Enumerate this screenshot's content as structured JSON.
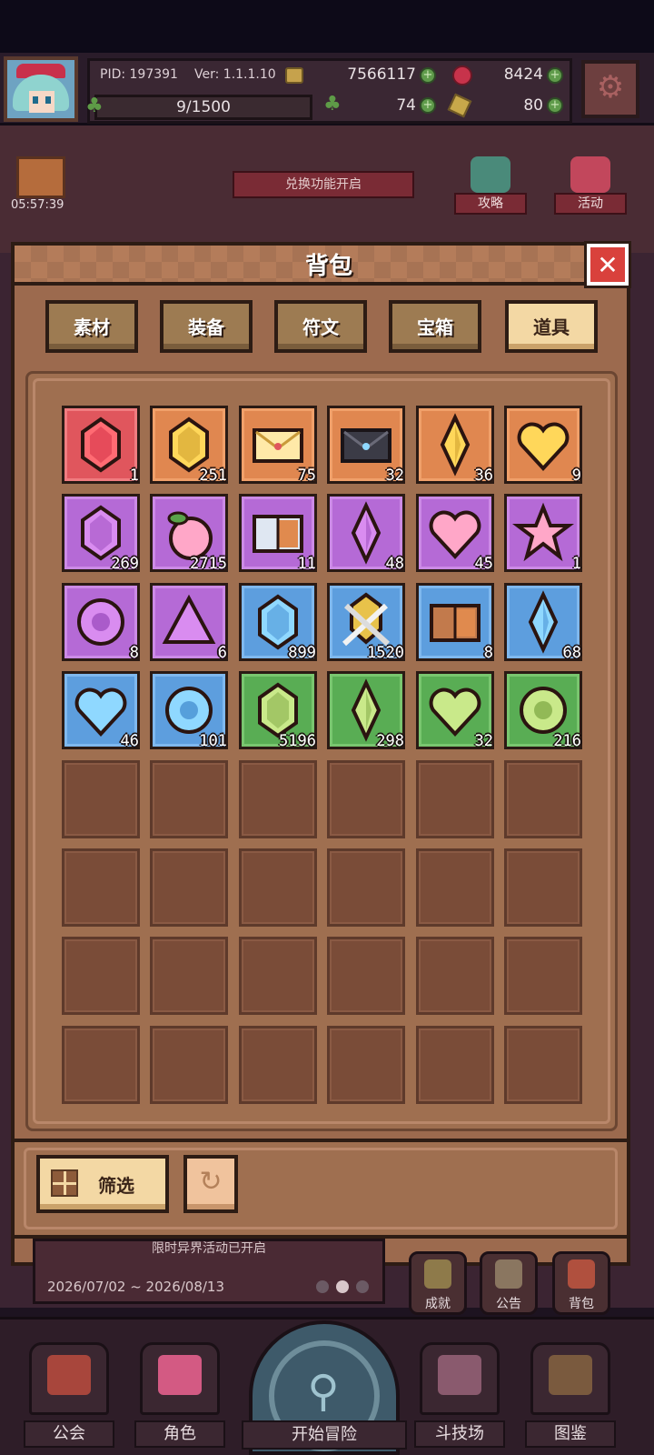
{
  "header": {
    "pid": "PID: 197391",
    "version": "Ver: 1.1.1.10",
    "gold": "7566117",
    "rubies": "8424",
    "level_progress": "9/1500",
    "clovers": "74",
    "hammers": "80"
  },
  "scene": {
    "gift_timer": "05:57:39",
    "top_banner": "兑换功能开启",
    "guide_label": "攻略",
    "activity_label": "活动"
  },
  "backpack": {
    "title": "背包",
    "tabs": [
      {
        "label": "素材",
        "active": false
      },
      {
        "label": "装备",
        "active": false
      },
      {
        "label": "符文",
        "active": false
      },
      {
        "label": "宝箱",
        "active": false
      },
      {
        "label": "道具",
        "active": true
      }
    ],
    "items": [
      {
        "icon": "red-gem-icon",
        "qty": "1"
      },
      {
        "icon": "gold-gem-icon",
        "qty": "251"
      },
      {
        "icon": "letter-icon",
        "qty": "75"
      },
      {
        "icon": "dark-letter-icon",
        "qty": "32"
      },
      {
        "icon": "gold-crystal-icon",
        "qty": "36"
      },
      {
        "icon": "gold-heart-icon",
        "qty": "9"
      },
      {
        "icon": "purple-gem-icon",
        "qty": "269"
      },
      {
        "icon": "pink-fruit-icon",
        "qty": "2715"
      },
      {
        "icon": "book-icon",
        "qty": "11"
      },
      {
        "icon": "purple-crystal-icon",
        "qty": "48"
      },
      {
        "icon": "pink-heart-icon",
        "qty": "45"
      },
      {
        "icon": "pink-star-icon",
        "qty": "1"
      },
      {
        "icon": "purple-orb-icon",
        "qty": "8"
      },
      {
        "icon": "purple-triangle-icon",
        "qty": "6"
      },
      {
        "icon": "blue-gem-icon",
        "qty": "899"
      },
      {
        "icon": "swords-emblem-icon",
        "qty": "1520"
      },
      {
        "icon": "brown-book-icon",
        "qty": "8"
      },
      {
        "icon": "blue-crystal-icon",
        "qty": "68"
      },
      {
        "icon": "blue-heart-icon",
        "qty": "46"
      },
      {
        "icon": "blue-orb-icon",
        "qty": "101"
      },
      {
        "icon": "green-gem-icon",
        "qty": "5196"
      },
      {
        "icon": "green-crystal-icon",
        "qty": "298"
      },
      {
        "icon": "green-heart-icon",
        "qty": "32"
      },
      {
        "icon": "green-orb-icon",
        "qty": "216"
      }
    ],
    "filter_label": "筛选"
  },
  "event": {
    "title": "限时异界活动已开启",
    "dates": "2026/07/02 ~ 2026/08/13"
  },
  "side_menu": {
    "achievements": "成就",
    "notice": "公告",
    "backpack": "背包"
  },
  "nav": {
    "guild": "公会",
    "character": "角色",
    "start": "开始冒险",
    "arena": "斗技场",
    "codex": "图鉴"
  },
  "colors": {
    "slot_red": "#e0565d",
    "slot_orange": "#e08750",
    "slot_purple": "#b56ad6",
    "slot_blue": "#5d9ede",
    "slot_green": "#59ad54",
    "tab_active": "#f3d8a4",
    "close_button": "#d9413c"
  }
}
